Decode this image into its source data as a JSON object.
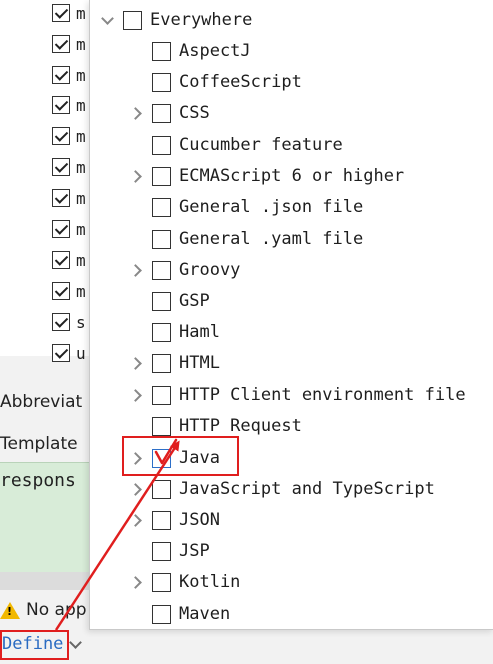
{
  "background": {
    "list_rows": [
      {
        "label": "m",
        "checked": true
      },
      {
        "label": "m",
        "checked": true
      },
      {
        "label": "m",
        "checked": true
      },
      {
        "label": "m",
        "checked": true
      },
      {
        "label": "m",
        "checked": true
      },
      {
        "label": "m",
        "checked": true
      },
      {
        "label": "m",
        "checked": true
      },
      {
        "label": "m",
        "checked": true
      },
      {
        "label": "m",
        "checked": true
      },
      {
        "label": "m",
        "checked": true
      },
      {
        "label": "s",
        "checked": true
      },
      {
        "label": "u",
        "checked": true
      }
    ],
    "abbreviation_label": "Abbreviat",
    "template_label": "Template",
    "template_text": "respons",
    "warning_text": "No app",
    "define_link": "Define"
  },
  "popup": {
    "items": [
      {
        "label": "Everywhere",
        "checked": false,
        "expander": "down"
      },
      {
        "label": "AspectJ",
        "checked": false,
        "expander": "none"
      },
      {
        "label": "CoffeeScript",
        "checked": false,
        "expander": "none"
      },
      {
        "label": "CSS",
        "checked": false,
        "expander": "right"
      },
      {
        "label": "Cucumber feature",
        "checked": false,
        "expander": "none"
      },
      {
        "label": "ECMAScript 6 or higher",
        "checked": false,
        "expander": "right"
      },
      {
        "label": "General .json file",
        "checked": false,
        "expander": "none"
      },
      {
        "label": "General .yaml file",
        "checked": false,
        "expander": "none"
      },
      {
        "label": "Groovy",
        "checked": false,
        "expander": "right"
      },
      {
        "label": "GSP",
        "checked": false,
        "expander": "none"
      },
      {
        "label": "Haml",
        "checked": false,
        "expander": "none"
      },
      {
        "label": "HTML",
        "checked": false,
        "expander": "right"
      },
      {
        "label": "HTTP Client environment file",
        "checked": false,
        "expander": "right"
      },
      {
        "label": "HTTP Request",
        "checked": false,
        "expander": "none"
      },
      {
        "label": "Java",
        "checked": true,
        "expander": "right"
      },
      {
        "label": "JavaScript and TypeScript",
        "checked": false,
        "expander": "right"
      },
      {
        "label": "JSON",
        "checked": false,
        "expander": "right"
      },
      {
        "label": "JSP",
        "checked": false,
        "expander": "none"
      },
      {
        "label": "Kotlin",
        "checked": false,
        "expander": "right"
      },
      {
        "label": "Maven",
        "checked": false,
        "expander": "none"
      }
    ]
  },
  "colors": {
    "annotation": "#e01e1e",
    "link": "#2a6bc2",
    "template_bg": "#d8ecd8"
  }
}
